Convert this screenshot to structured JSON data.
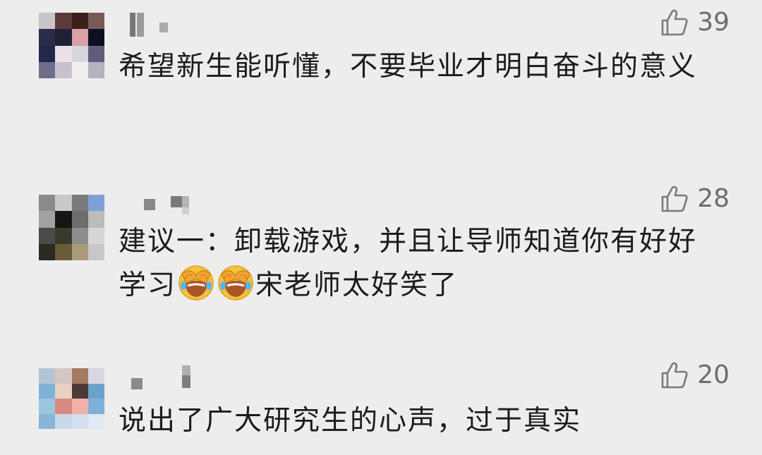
{
  "comments": [
    {
      "likes": "39",
      "text": "希望新生能听懂，不要毕业才明白奋斗的意义",
      "avatar_colors": [
        "#c9c4c8",
        "#5d3a3a",
        "#3b1f1d",
        "#7a5a57",
        "#2b2c47",
        "#1f2035",
        "#d9a0a8",
        "#0d0f22",
        "#24264b",
        "#e9e1e6",
        "#d8d5dc",
        "#5e5e7a",
        "#6e6e8c",
        "#c7c2cc",
        "#f1eef2",
        "#b4b2be"
      ]
    },
    {
      "likes": "28",
      "text_parts": {
        "before": "建议一：卸载游戏，并且让导师知道你有好好学习",
        "emoji": "face-palm-laughing-emoji",
        "after": "宋老师太好笑了"
      },
      "avatar_colors": [
        "#8a8a8a",
        "#c9c9c9",
        "#7a7a7a",
        "#7da0d8",
        "#a1a1a1",
        "#151515",
        "#6c6c6c",
        "#bcbcbc",
        "#4a4a4a",
        "#3a3a2a",
        "#8d8d8d",
        "#d6d6d6",
        "#2a2a22",
        "#6b5a3a",
        "#a99a7a",
        "#c8c8c8"
      ]
    },
    {
      "likes": "20",
      "text": "说出了广大研究生的心声，过于真实",
      "avatar_colors": [
        "#b2c4d8",
        "#d6c7c2",
        "#a47b60",
        "#dad7e5",
        "#7fb2d7",
        "#e8d2c4",
        "#4a3a3a",
        "#6ca3cb",
        "#9ac7de",
        "#d98a80",
        "#f0b2a8",
        "#7fb0d7",
        "#8ab3d8",
        "#c9d8ec",
        "#d2e0ef",
        "#e1eaf5"
      ]
    }
  ]
}
